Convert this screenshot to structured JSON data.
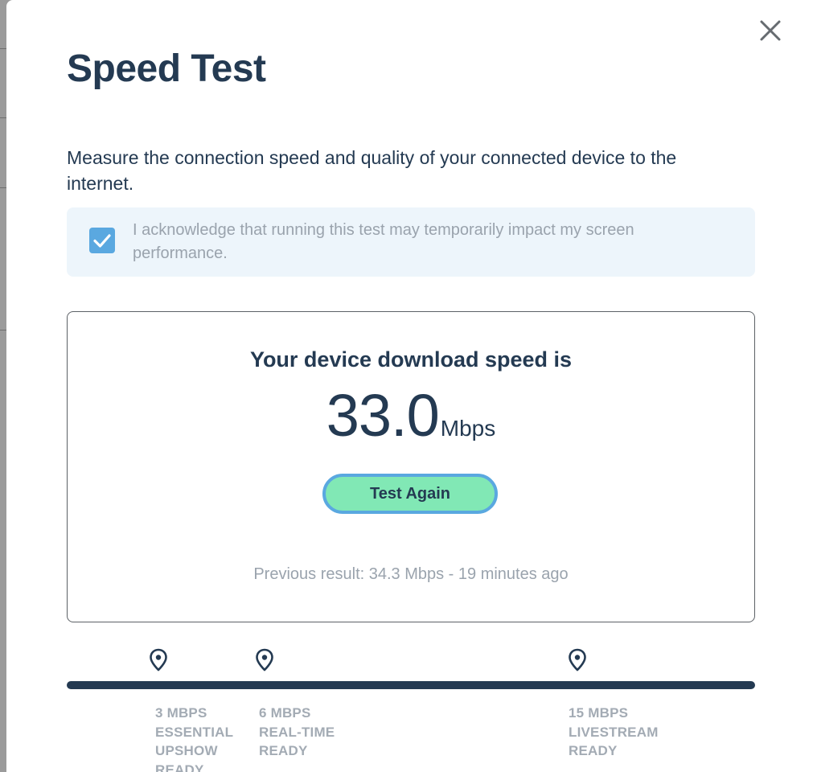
{
  "modal": {
    "title": "Speed Test",
    "description": "Measure the connection speed and quality of your connected device to the internet.",
    "acknowledgement": {
      "checked": true,
      "text": "I acknowledge that running this test may temporarily impact my screen performance."
    }
  },
  "result": {
    "heading": "Your device download speed is",
    "speed_value": "33.0",
    "speed_unit": "Mbps",
    "test_again_label": "Test Again",
    "previous_result": "Previous result: 34.3 Mbps - 19 minutes ago"
  },
  "scale": {
    "thresholds": [
      {
        "speed": "3 MBPS",
        "line2": "ESSENTIAL",
        "line3": "UPSHOW",
        "line4": "READY"
      },
      {
        "speed": "6 MBPS",
        "line2": "REAL-TIME",
        "line3": "READY",
        "line4": ""
      },
      {
        "speed": "15 MBPS",
        "line2": "LIVESTREAM",
        "line3": "READY",
        "line4": ""
      }
    ]
  },
  "icons": {
    "close": "close-icon",
    "checkbox": "checkmark-icon",
    "pin": "map-pin-icon"
  },
  "colors": {
    "navy": "#243a52",
    "accent_green": "#81e8b5",
    "accent_blue": "#5aa8e0",
    "muted_text": "#9aa3ad",
    "ack_background": "#edf5fb"
  }
}
